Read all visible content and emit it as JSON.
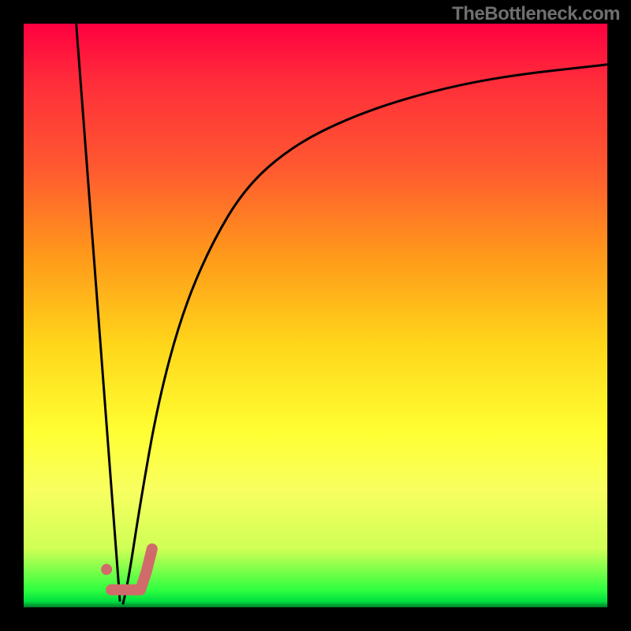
{
  "attribution": "TheBottleneck.com",
  "colors": {
    "gradient_top": "#ff0040",
    "gradient_bottom": "#007a2a",
    "curve": "#000000",
    "marker": "#d16a6a",
    "frame": "#000000"
  },
  "chart_data": {
    "type": "line",
    "title": "",
    "xlabel": "",
    "ylabel": "",
    "xlim": [
      0,
      100
    ],
    "ylim": [
      0,
      100
    ],
    "series": [
      {
        "name": "descending-line",
        "x": [
          9,
          16.5
        ],
        "y": [
          100,
          1
        ]
      },
      {
        "name": "rising-curve",
        "x": [
          17,
          18,
          20,
          23,
          27,
          32,
          38,
          46,
          56,
          68,
          82,
          100
        ],
        "y": [
          0.5,
          5,
          18,
          35,
          50,
          62,
          72,
          79,
          84,
          88,
          91,
          93
        ]
      }
    ],
    "marker": {
      "name": "j-shape",
      "dot": {
        "x": 14.2,
        "y": 6.5
      },
      "path": [
        {
          "x": 15.0,
          "y": 3.0
        },
        {
          "x": 17.5,
          "y": 3.0
        },
        {
          "x": 20.0,
          "y": 3.0
        },
        {
          "x": 21.0,
          "y": 6.0
        },
        {
          "x": 22.0,
          "y": 10.0
        }
      ]
    }
  }
}
